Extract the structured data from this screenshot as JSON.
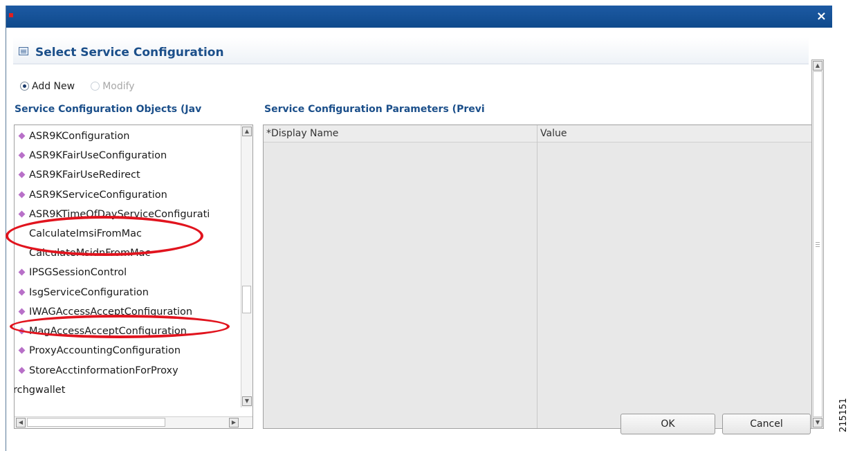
{
  "window": {
    "close_glyph": "×"
  },
  "panel": {
    "title": "Select Service Configuration"
  },
  "mode": {
    "add_new_label": "Add New",
    "modify_label": "Modify",
    "selected": "Add New"
  },
  "objects_section": {
    "heading": "Service Configuration Objects (Jav",
    "items": [
      {
        "label": "ASR9KConfiguration",
        "icon": "diamond-icon"
      },
      {
        "label": "ASR9KFairUseConfiguration",
        "icon": "diamond-icon"
      },
      {
        "label": "ASR9KFairUseRedirect",
        "icon": "diamond-icon"
      },
      {
        "label": "ASR9KServiceConfiguration",
        "icon": "diamond-icon"
      },
      {
        "label": "ASR9KTimeOfDayServiceConfigurati",
        "icon": "diamond-icon"
      },
      {
        "label": "CalculateImsiFromMac",
        "icon": ""
      },
      {
        "label": "CalculateMsidnFromMac",
        "icon": ""
      },
      {
        "label": "IPSGSessionControl",
        "icon": "diamond-icon"
      },
      {
        "label": "IsgServiceConfiguration",
        "icon": "diamond-icon"
      },
      {
        "label": "IWAGAccessAcceptConfiguration",
        "icon": "diamond-icon"
      },
      {
        "label": "MagAccessAcceptConfiguration",
        "icon": "diamond-icon"
      },
      {
        "label": "ProxyAccountingConfiguration",
        "icon": "diamond-icon"
      },
      {
        "label": "StoreAcctinformationForProxy",
        "icon": "diamond-icon"
      },
      {
        "label": "rchgwallet",
        "icon": ""
      }
    ]
  },
  "parameters_section": {
    "heading": "Service Configuration Parameters (Previ",
    "columns": [
      "*Display Name",
      "Value"
    ]
  },
  "buttons": {
    "ok": "OK",
    "cancel": "Cancel"
  },
  "figure_id": "215151",
  "colors": {
    "titlebar": "#1659a1",
    "heading": "#1b4f8a",
    "highlight_ellipse": "#e1141e",
    "item_icon": "#b870c8"
  }
}
